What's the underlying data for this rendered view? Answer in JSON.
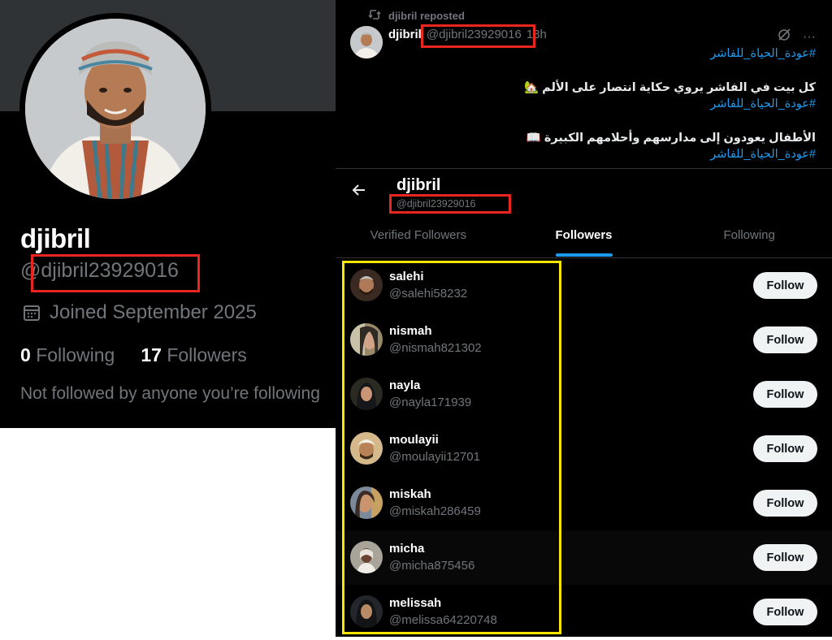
{
  "profile": {
    "name": "djibril",
    "handle": "@djibril23929016",
    "joined": "Joined September 2025",
    "following_count": "0",
    "following_label": "Following",
    "followers_count": "17",
    "followers_label": "Followers",
    "not_followed": "Not followed by anyone you’re following"
  },
  "tweet": {
    "repost_label": "djibril reposted",
    "author_name": "djibril",
    "author_handle": "@djibril23929016",
    "time": "18h",
    "more_label": "···",
    "hashtag": "#عودة_الحياة_للفاشر",
    "line1": "كل بيت في الفاشر يروي حكاية انتصار على الألم 🏡",
    "line2": "الأطفال يعودون إلى مدارسهم وأحلامهم الكبيرة 📖"
  },
  "followers_header": {
    "name": "djibril",
    "handle": "@djibril23929016"
  },
  "tabs": [
    "Verified Followers",
    "Followers",
    "Following"
  ],
  "follow_label": "Follow",
  "followers": [
    {
      "name": "salehi",
      "handle": "@salehi58232"
    },
    {
      "name": "nismah",
      "handle": "@nismah821302"
    },
    {
      "name": "nayla",
      "handle": "@nayla171939"
    },
    {
      "name": "moulayii",
      "handle": "@moulayii12701"
    },
    {
      "name": "miskah",
      "handle": "@miskah286459"
    },
    {
      "name": "micha",
      "handle": "@micha875456"
    },
    {
      "name": "melissah",
      "handle": "@melissa64220748"
    }
  ],
  "colors": {
    "background": "#000000",
    "accent": "#1d9bf0",
    "muted": "#71767b",
    "highlight_red": "#e8261f",
    "highlight_yellow": "#ffe600"
  }
}
